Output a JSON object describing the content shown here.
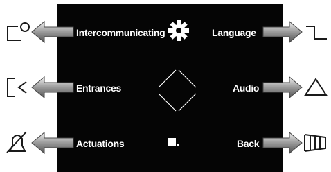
{
  "menu": {
    "left": [
      {
        "label": "Intercommunicating",
        "icon": "door-intercom-icon"
      },
      {
        "label": "Entrances",
        "icon": "entrance-icon"
      },
      {
        "label": "Actuations",
        "icon": "bell-muted-icon"
      }
    ],
    "right": [
      {
        "label": "Language",
        "icon": "bracket-icon"
      },
      {
        "label": "Audio",
        "icon": "triangle-icon"
      },
      {
        "label": "Back",
        "icon": "gate-icon"
      }
    ],
    "center_icons": [
      "settings-gear-icon",
      "nav-diamond-icon",
      "stop-square-icon"
    ]
  },
  "colors": {
    "screen_bg": "#050505",
    "text": "#ffffff",
    "arrow_light": "#f2f2f2",
    "arrow_mid": "#9a9a9a",
    "arrow_dark": "#555555",
    "icon_stroke": "#1a1a1a"
  }
}
